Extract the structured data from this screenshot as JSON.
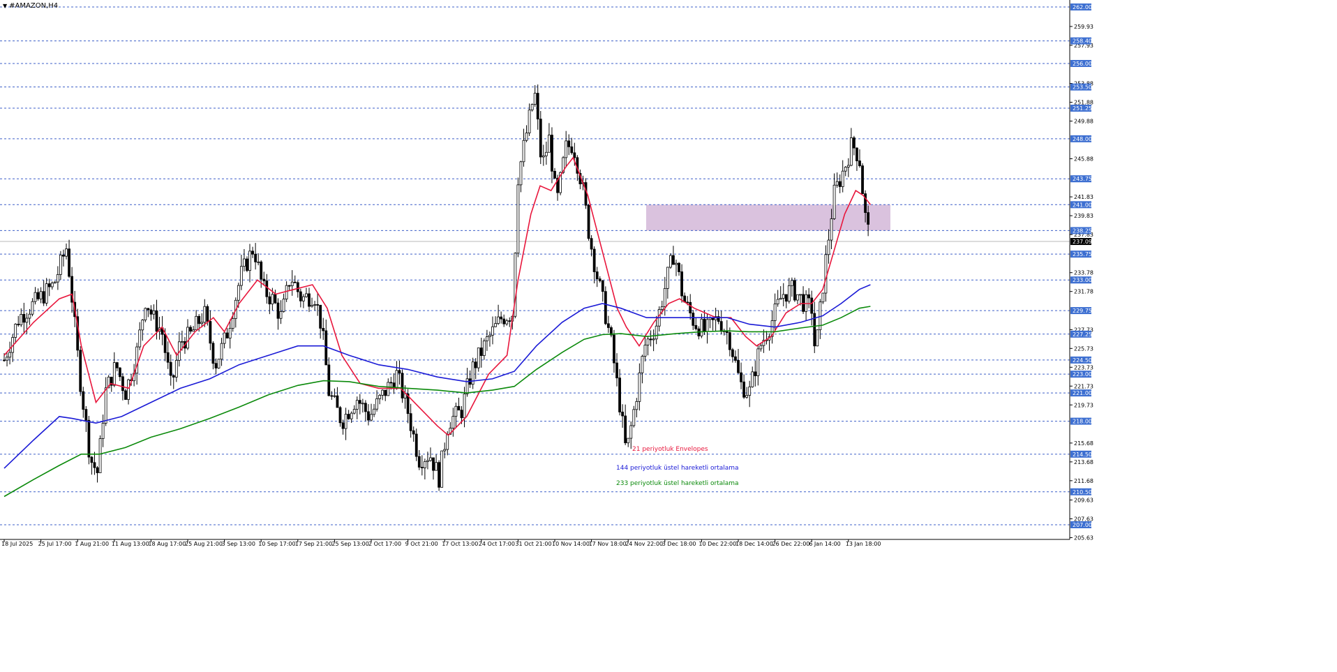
{
  "window": {
    "title": "#AMAZON,H4",
    "menu_icon": "triangle-down-icon"
  },
  "colors": {
    "background": "#ffffff",
    "grid_blue": "#3c5fc8",
    "price_tag_bg": "#3d6fd1",
    "current_tag_bg": "#000000",
    "zone_fill": "#d8bfdc",
    "envelope": "#e8163c",
    "ema144": "#1a1ad6",
    "ema233": "#0b8a0b",
    "candle": "#000000"
  },
  "chart_data": {
    "type": "candlestick",
    "symbol": "#AMAZON",
    "timeframe": "H4",
    "ylim": [
      204.9,
      262.8
    ],
    "current_price": "237.09",
    "price_axis_ticks": [
      "259.93",
      "257.93",
      "253.88",
      "251.88",
      "249.88",
      "245.88",
      "241.83",
      "239.83",
      "237.83",
      "233.78",
      "231.78",
      "227.73",
      "225.73",
      "223.73",
      "221.73",
      "219.73",
      "215.68",
      "213.68",
      "211.68",
      "209.63",
      "207.63",
      "205.63"
    ],
    "horizontal_levels": [
      "262.00",
      "258.40",
      "256.00",
      "253.50",
      "251.25",
      "248.00",
      "243.75",
      "241.00",
      "238.25",
      "235.75",
      "233.00",
      "229.75",
      "227.25",
      "224.50",
      "223.00",
      "221.00",
      "218.00",
      "214.50",
      "210.50",
      "207.00"
    ],
    "x_labels": [
      "18 Jul 2025",
      "25 Jul 17:00",
      "1 Aug 21:00",
      "11 Aug 13:00",
      "18 Aug 17:00",
      "25 Aug 21:00",
      "3 Sep 13:00",
      "10 Sep 17:00",
      "17 Sep 21:00",
      "25 Sep 13:00",
      "2 Oct 17:00",
      "9 Oct 21:00",
      "17 Oct 13:00",
      "24 Oct 17:00",
      "31 Oct 21:00",
      "10 Nov 14:00",
      "17 Nov 18:00",
      "24 Nov 22:00",
      "3 Dec 18:00",
      "10 Dec 22:00",
      "18 Dec 14:00",
      "26 Dec 22:00",
      "6 Jan 14:00",
      "13 Jan 18:00"
    ],
    "resistance_zone": {
      "low": 238.25,
      "high": 241.0
    },
    "close_path": [
      {
        "t": 0,
        "p": 224.5
      },
      {
        "t": 0.4,
        "p": 229
      },
      {
        "t": 0.9,
        "p": 230.8
      },
      {
        "t": 1.35,
        "p": 232.5
      },
      {
        "t": 1.7,
        "p": 236.5
      },
      {
        "t": 1.85,
        "p": 231
      },
      {
        "t": 2.05,
        "p": 223
      },
      {
        "t": 2.35,
        "p": 214
      },
      {
        "t": 2.55,
        "p": 212.5
      },
      {
        "t": 2.75,
        "p": 221
      },
      {
        "t": 3.05,
        "p": 224
      },
      {
        "t": 3.3,
        "p": 221
      },
      {
        "t": 3.6,
        "p": 225
      },
      {
        "t": 3.85,
        "p": 231
      },
      {
        "t": 4.05,
        "p": 229
      },
      {
        "t": 4.3,
        "p": 227.5
      },
      {
        "t": 4.55,
        "p": 221.5
      },
      {
        "t": 4.8,
        "p": 226.5
      },
      {
        "t": 5.05,
        "p": 227
      },
      {
        "t": 5.45,
        "p": 229.5
      },
      {
        "t": 5.75,
        "p": 224
      },
      {
        "t": 6.05,
        "p": 227
      },
      {
        "t": 6.45,
        "p": 233.5
      },
      {
        "t": 6.8,
        "p": 236.5
      },
      {
        "t": 7.05,
        "p": 232
      },
      {
        "t": 7.3,
        "p": 231
      },
      {
        "t": 7.55,
        "p": 229
      },
      {
        "t": 7.8,
        "p": 233.5
      },
      {
        "t": 8.1,
        "p": 231
      },
      {
        "t": 8.45,
        "p": 231.5
      },
      {
        "t": 8.65,
        "p": 228
      },
      {
        "t": 8.85,
        "p": 221
      },
      {
        "t": 9.2,
        "p": 218
      },
      {
        "t": 9.6,
        "p": 220.5
      },
      {
        "t": 9.95,
        "p": 218.5
      },
      {
        "t": 10.35,
        "p": 221
      },
      {
        "t": 10.7,
        "p": 223
      },
      {
        "t": 11.0,
        "p": 219
      },
      {
        "t": 11.3,
        "p": 214
      },
      {
        "t": 11.6,
        "p": 214.5
      },
      {
        "t": 11.85,
        "p": 212
      },
      {
        "t": 12.1,
        "p": 218
      },
      {
        "t": 12.45,
        "p": 219
      },
      {
        "t": 12.75,
        "p": 223.5
      },
      {
        "t": 13.15,
        "p": 226.5
      },
      {
        "t": 13.55,
        "p": 229
      },
      {
        "t": 13.85,
        "p": 229.5
      },
      {
        "t": 14.0,
        "p": 244
      },
      {
        "t": 14.2,
        "p": 248
      },
      {
        "t": 14.45,
        "p": 253
      },
      {
        "t": 14.65,
        "p": 245
      },
      {
        "t": 14.85,
        "p": 248
      },
      {
        "t": 15.05,
        "p": 241
      },
      {
        "t": 15.3,
        "p": 247
      },
      {
        "t": 15.5,
        "p": 247.5
      },
      {
        "t": 15.75,
        "p": 243
      },
      {
        "t": 15.95,
        "p": 237.5
      },
      {
        "t": 16.15,
        "p": 233.5
      },
      {
        "t": 16.35,
        "p": 230
      },
      {
        "t": 16.55,
        "p": 226
      },
      {
        "t": 16.8,
        "p": 219
      },
      {
        "t": 16.95,
        "p": 214.5
      },
      {
        "t": 17.15,
        "p": 219
      },
      {
        "t": 17.45,
        "p": 226
      },
      {
        "t": 17.75,
        "p": 228
      },
      {
        "t": 18.05,
        "p": 233
      },
      {
        "t": 18.25,
        "p": 236
      },
      {
        "t": 18.5,
        "p": 231
      },
      {
        "t": 18.8,
        "p": 228.5
      },
      {
        "t": 19.1,
        "p": 227.5
      },
      {
        "t": 19.45,
        "p": 229
      },
      {
        "t": 19.75,
        "p": 227
      },
      {
        "t": 20.05,
        "p": 222
      },
      {
        "t": 20.3,
        "p": 221
      },
      {
        "t": 20.6,
        "p": 226
      },
      {
        "t": 20.9,
        "p": 228.5
      },
      {
        "t": 21.2,
        "p": 231.5
      },
      {
        "t": 21.5,
        "p": 232
      },
      {
        "t": 21.8,
        "p": 230.5
      },
      {
        "t": 22.0,
        "p": 230
      },
      {
        "t": 22.1,
        "p": 225
      },
      {
        "t": 22.35,
        "p": 234
      },
      {
        "t": 22.6,
        "p": 242
      },
      {
        "t": 22.9,
        "p": 245
      },
      {
        "t": 23.1,
        "p": 247.5
      },
      {
        "t": 23.3,
        "p": 246
      },
      {
        "t": 23.45,
        "p": 240
      },
      {
        "t": 23.6,
        "p": 237
      }
    ],
    "series": [
      {
        "name": "21 periyotluk Envelopes",
        "color": "#e8163c",
        "points": [
          {
            "t": 0,
            "p": 225
          },
          {
            "t": 0.8,
            "p": 228.5
          },
          {
            "t": 1.5,
            "p": 231
          },
          {
            "t": 1.85,
            "p": 231.5
          },
          {
            "t": 2.1,
            "p": 226
          },
          {
            "t": 2.5,
            "p": 220
          },
          {
            "t": 2.9,
            "p": 222
          },
          {
            "t": 3.4,
            "p": 221.5
          },
          {
            "t": 3.8,
            "p": 226
          },
          {
            "t": 4.3,
            "p": 228
          },
          {
            "t": 4.7,
            "p": 225
          },
          {
            "t": 5.2,
            "p": 227.5
          },
          {
            "t": 5.7,
            "p": 229
          },
          {
            "t": 6.0,
            "p": 227.5
          },
          {
            "t": 6.4,
            "p": 230.5
          },
          {
            "t": 6.9,
            "p": 233
          },
          {
            "t": 7.4,
            "p": 231.5
          },
          {
            "t": 7.9,
            "p": 232
          },
          {
            "t": 8.4,
            "p": 232.5
          },
          {
            "t": 8.8,
            "p": 230
          },
          {
            "t": 9.2,
            "p": 225
          },
          {
            "t": 9.7,
            "p": 222
          },
          {
            "t": 10.2,
            "p": 221.5
          },
          {
            "t": 10.8,
            "p": 221.5
          },
          {
            "t": 11.3,
            "p": 219.5
          },
          {
            "t": 11.8,
            "p": 217.5
          },
          {
            "t": 12.1,
            "p": 216.5
          },
          {
            "t": 12.6,
            "p": 218.5
          },
          {
            "t": 13.2,
            "p": 223
          },
          {
            "t": 13.7,
            "p": 225
          },
          {
            "t": 14.0,
            "p": 233
          },
          {
            "t": 14.35,
            "p": 240
          },
          {
            "t": 14.6,
            "p": 243
          },
          {
            "t": 14.9,
            "p": 242.5
          },
          {
            "t": 15.3,
            "p": 245
          },
          {
            "t": 15.5,
            "p": 246
          },
          {
            "t": 15.9,
            "p": 242
          },
          {
            "t": 16.3,
            "p": 236
          },
          {
            "t": 16.7,
            "p": 230
          },
          {
            "t": 16.95,
            "p": 228
          },
          {
            "t": 17.3,
            "p": 226
          },
          {
            "t": 17.7,
            "p": 228.5
          },
          {
            "t": 18.1,
            "p": 230.5
          },
          {
            "t": 18.4,
            "p": 231
          },
          {
            "t": 18.8,
            "p": 230
          },
          {
            "t": 19.4,
            "p": 229
          },
          {
            "t": 19.8,
            "p": 229
          },
          {
            "t": 20.2,
            "p": 227
          },
          {
            "t": 20.5,
            "p": 226
          },
          {
            "t": 20.9,
            "p": 227
          },
          {
            "t": 21.3,
            "p": 229.5
          },
          {
            "t": 21.7,
            "p": 230.5
          },
          {
            "t": 22.0,
            "p": 230.5
          },
          {
            "t": 22.3,
            "p": 232
          },
          {
            "t": 22.6,
            "p": 236
          },
          {
            "t": 22.9,
            "p": 240
          },
          {
            "t": 23.2,
            "p": 242.5
          },
          {
            "t": 23.4,
            "p": 242
          },
          {
            "t": 23.6,
            "p": 241
          }
        ]
      },
      {
        "name": "144 periyotluk üstel hareketli ortalama",
        "color": "#1a1ad6",
        "points": [
          {
            "t": 0,
            "p": 213
          },
          {
            "t": 0.8,
            "p": 216
          },
          {
            "t": 1.5,
            "p": 218.5
          },
          {
            "t": 1.85,
            "p": 218.3
          },
          {
            "t": 2.5,
            "p": 217.8
          },
          {
            "t": 3.2,
            "p": 218.5
          },
          {
            "t": 4.0,
            "p": 220
          },
          {
            "t": 4.8,
            "p": 221.5
          },
          {
            "t": 5.6,
            "p": 222.5
          },
          {
            "t": 6.4,
            "p": 224
          },
          {
            "t": 7.2,
            "p": 225
          },
          {
            "t": 8.0,
            "p": 226
          },
          {
            "t": 8.7,
            "p": 226
          },
          {
            "t": 9.4,
            "p": 225
          },
          {
            "t": 10.2,
            "p": 224
          },
          {
            "t": 11.0,
            "p": 223.5
          },
          {
            "t": 11.8,
            "p": 222.7
          },
          {
            "t": 12.6,
            "p": 222.2
          },
          {
            "t": 13.3,
            "p": 222.5
          },
          {
            "t": 13.9,
            "p": 223.3
          },
          {
            "t": 14.5,
            "p": 226
          },
          {
            "t": 15.2,
            "p": 228.5
          },
          {
            "t": 15.8,
            "p": 230
          },
          {
            "t": 16.3,
            "p": 230.5
          },
          {
            "t": 16.8,
            "p": 230
          },
          {
            "t": 17.5,
            "p": 229
          },
          {
            "t": 18.3,
            "p": 229
          },
          {
            "t": 19.0,
            "p": 229
          },
          {
            "t": 19.7,
            "p": 229
          },
          {
            "t": 20.3,
            "p": 228.3
          },
          {
            "t": 21.0,
            "p": 228
          },
          {
            "t": 21.7,
            "p": 228.5
          },
          {
            "t": 22.3,
            "p": 229.2
          },
          {
            "t": 22.8,
            "p": 230.5
          },
          {
            "t": 23.3,
            "p": 232
          },
          {
            "t": 23.6,
            "p": 232.5
          }
        ]
      },
      {
        "name": "233 periyotluk üstel hareketli ortalama",
        "color": "#0b8a0b",
        "points": [
          {
            "t": 0,
            "p": 210
          },
          {
            "t": 0.8,
            "p": 211.8
          },
          {
            "t": 1.5,
            "p": 213.3
          },
          {
            "t": 2.1,
            "p": 214.5
          },
          {
            "t": 2.6,
            "p": 214.5
          },
          {
            "t": 3.3,
            "p": 215.2
          },
          {
            "t": 4.0,
            "p": 216.3
          },
          {
            "t": 4.8,
            "p": 217.2
          },
          {
            "t": 5.6,
            "p": 218.3
          },
          {
            "t": 6.4,
            "p": 219.5
          },
          {
            "t": 7.2,
            "p": 220.8
          },
          {
            "t": 8.0,
            "p": 221.8
          },
          {
            "t": 8.7,
            "p": 222.3
          },
          {
            "t": 9.4,
            "p": 222.2
          },
          {
            "t": 10.2,
            "p": 221.7
          },
          {
            "t": 11.0,
            "p": 221.5
          },
          {
            "t": 11.8,
            "p": 221.3
          },
          {
            "t": 12.6,
            "p": 221
          },
          {
            "t": 13.3,
            "p": 221.3
          },
          {
            "t": 13.9,
            "p": 221.7
          },
          {
            "t": 14.5,
            "p": 223.5
          },
          {
            "t": 15.2,
            "p": 225.3
          },
          {
            "t": 15.8,
            "p": 226.7
          },
          {
            "t": 16.3,
            "p": 227.2
          },
          {
            "t": 16.8,
            "p": 227.3
          },
          {
            "t": 17.5,
            "p": 227
          },
          {
            "t": 18.3,
            "p": 227.3
          },
          {
            "t": 19.0,
            "p": 227.5
          },
          {
            "t": 19.7,
            "p": 227.6
          },
          {
            "t": 20.3,
            "p": 227.5
          },
          {
            "t": 21.0,
            "p": 227.5
          },
          {
            "t": 21.7,
            "p": 227.9
          },
          {
            "t": 22.3,
            "p": 228.2
          },
          {
            "t": 22.8,
            "p": 229
          },
          {
            "t": 23.3,
            "p": 230
          },
          {
            "t": 23.6,
            "p": 230.2
          }
        ]
      }
    ],
    "annotations": [
      {
        "text": "21 periyotluk Envelopes",
        "color": "#e8163c"
      },
      {
        "text": "144 periyotluk üstel hareketli ortalama",
        "color": "#1a1ad6"
      },
      {
        "text": "233 periyotluk üstel hareketli ortalama",
        "color": "#0b8a0b"
      }
    ]
  }
}
